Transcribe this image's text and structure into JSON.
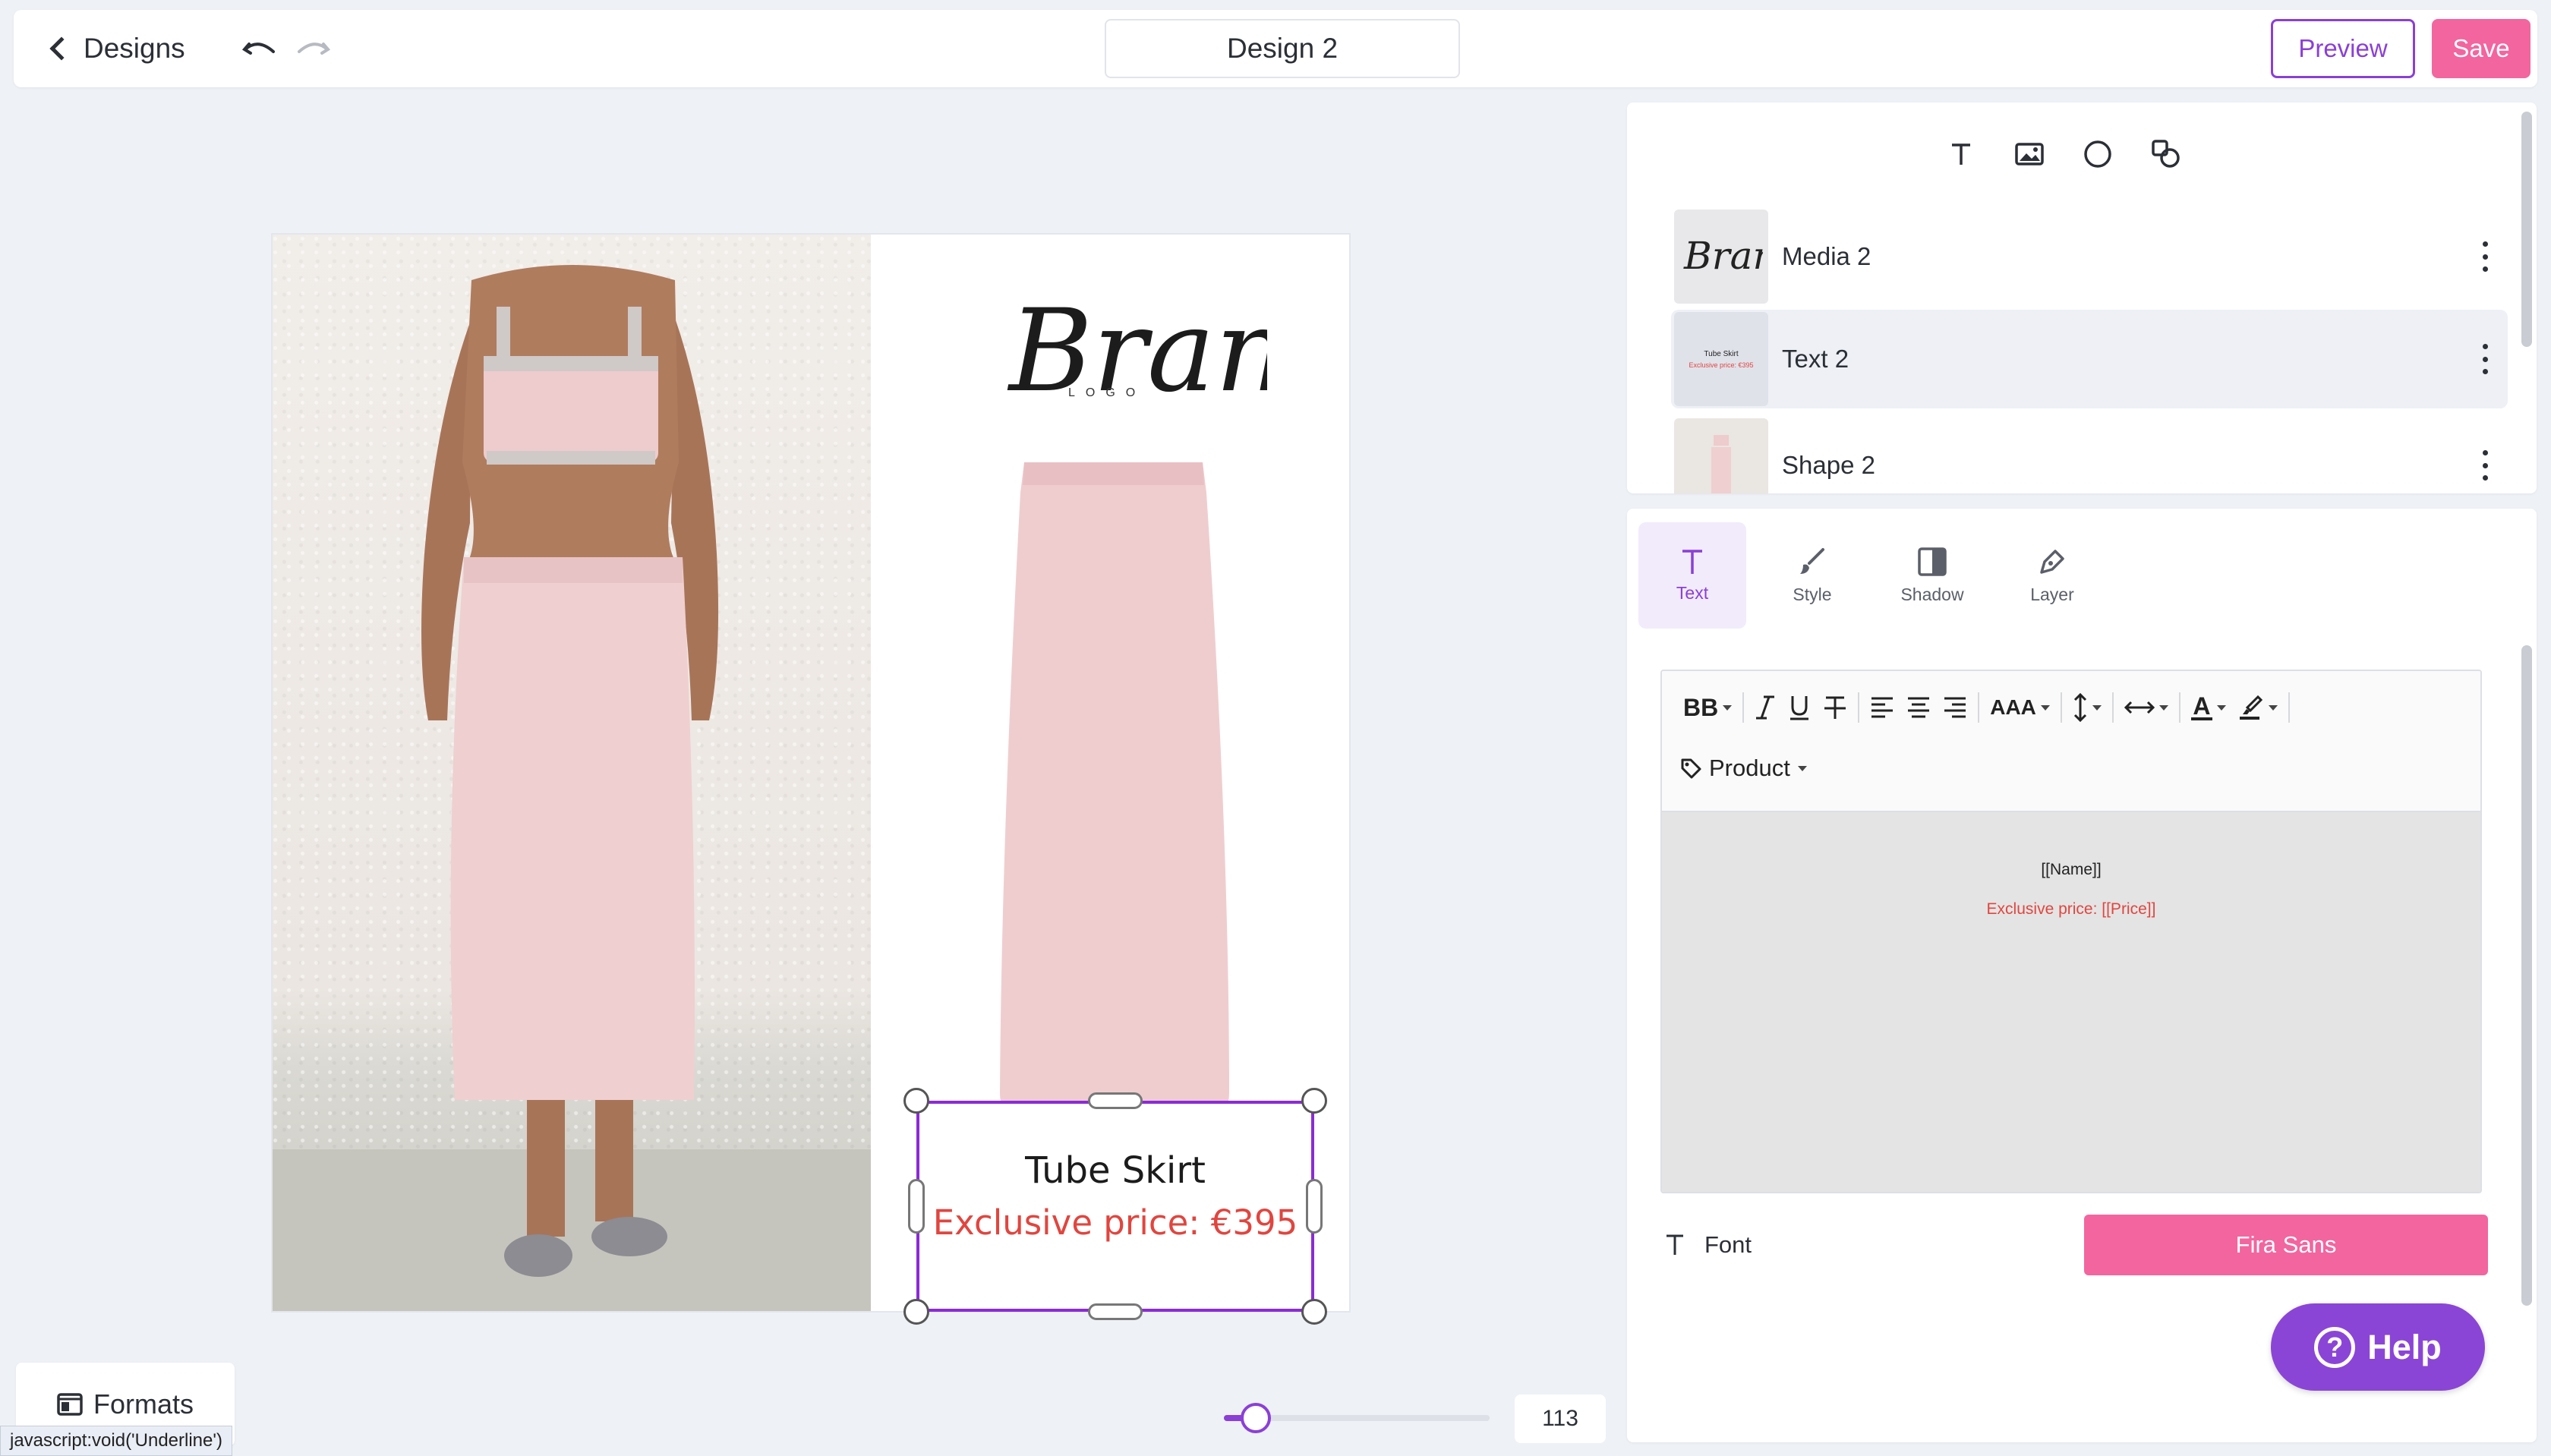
{
  "header": {
    "back_label": "Designs",
    "design_title": "Design 2",
    "preview_label": "Preview",
    "save_label": "Save"
  },
  "canvas": {
    "brand_logo_word": "Brand",
    "brand_logo_sub": "LOGO",
    "product_name": "Tube Skirt",
    "product_price": "Exclusive price: €395"
  },
  "layers": {
    "items": [
      {
        "label": "Media 2",
        "thumb": "brand-logo"
      },
      {
        "label": "Text 2",
        "thumb": "text"
      },
      {
        "label": "Shape 2",
        "thumb": "model-photo"
      }
    ],
    "thumb_text_name": "Tube Skirt",
    "thumb_text_price": "Exclusive price: €395"
  },
  "properties": {
    "tabs": [
      {
        "label": "Text",
        "icon": "text-icon",
        "active": true
      },
      {
        "label": "Style",
        "icon": "brush-icon",
        "active": false
      },
      {
        "label": "Shadow",
        "icon": "shadow-icon",
        "active": false
      },
      {
        "label": "Layer",
        "icon": "pen-icon",
        "active": false
      }
    ],
    "toolbar": {
      "bold_label": "BB",
      "case_label": "AAA",
      "color_label": "A",
      "product_label": "Product"
    },
    "editor": {
      "line1": "[[Name]]",
      "line2": "Exclusive price: [[Price]]"
    },
    "font_label": "Font",
    "font_value": "Fira Sans"
  },
  "help_label": "Help",
  "formats_label": "Formats",
  "status_url": "javascript:void('Underline')",
  "zoom": {
    "value": "113",
    "fraction": 0.12
  },
  "colors": {
    "accent": "#8b3fd6",
    "pink": "#f3659f",
    "price_red": "#e0463f"
  }
}
